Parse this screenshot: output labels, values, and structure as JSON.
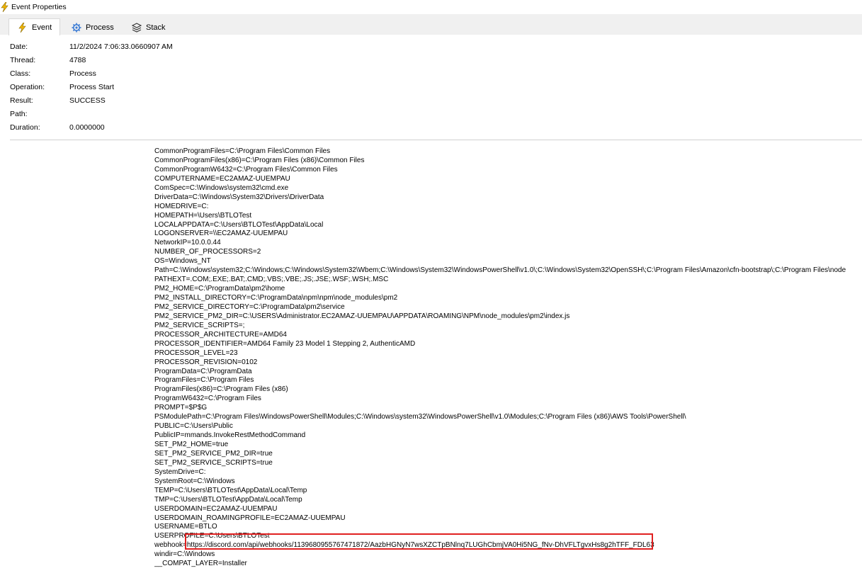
{
  "window": {
    "title": "Event Properties",
    "title_icon": "lightning-bolt-icon"
  },
  "tabs": [
    {
      "label": "Event",
      "icon": "lightning-bolt-icon",
      "active": true
    },
    {
      "label": "Process",
      "icon": "gear-icon",
      "active": false
    },
    {
      "label": "Stack",
      "icon": "stack-layers-icon",
      "active": false
    }
  ],
  "properties": [
    {
      "label": "Date:",
      "value": "11/2/2024 7:06:33.0660907 AM"
    },
    {
      "label": "Thread:",
      "value": "4788"
    },
    {
      "label": "Class:",
      "value": "Process"
    },
    {
      "label": "Operation:",
      "value": "Process Start"
    },
    {
      "label": "Result:",
      "value": "SUCCESS"
    },
    {
      "label": "Path:",
      "value": ""
    },
    {
      "label": "Duration:",
      "value": "0.0000000"
    }
  ],
  "environment": [
    "CommonProgramFiles=C:\\Program Files\\Common Files",
    "CommonProgramFiles(x86)=C:\\Program Files (x86)\\Common Files",
    "CommonProgramW6432=C:\\Program Files\\Common Files",
    "COMPUTERNAME=EC2AMAZ-UUEMPAU",
    "ComSpec=C:\\Windows\\system32\\cmd.exe",
    "DriverData=C:\\Windows\\System32\\Drivers\\DriverData",
    "HOMEDRIVE=C:",
    "HOMEPATH=\\Users\\BTLOTest",
    "LOCALAPPDATA=C:\\Users\\BTLOTest\\AppData\\Local",
    "LOGONSERVER=\\\\EC2AMAZ-UUEMPAU",
    "NetworkIP=10.0.0.44",
    "NUMBER_OF_PROCESSORS=2",
    "OS=Windows_NT",
    "Path=C:\\Windows\\system32;C:\\Windows;C:\\Windows\\System32\\Wbem;C:\\Windows\\System32\\WindowsPowerShell\\v1.0\\;C:\\Windows\\System32\\OpenSSH\\;C:\\Program Files\\Amazon\\cfn-bootstrap\\;C:\\Program Files\\node",
    "PATHEXT=.COM;.EXE;.BAT;.CMD;.VBS;.VBE;.JS;.JSE;.WSF;.WSH;.MSC",
    "PM2_HOME=C:\\ProgramData\\pm2\\home",
    "PM2_INSTALL_DIRECTORY=C:\\ProgramData\\npm\\npm\\node_modules\\pm2",
    "PM2_SERVICE_DIRECTORY=C:\\ProgramData\\pm2\\service",
    "PM2_SERVICE_PM2_DIR=C:\\USERS\\Administrator.EC2AMAZ-UUEMPAU\\APPDATA\\ROAMING\\NPM\\node_modules\\pm2\\index.js",
    "PM2_SERVICE_SCRIPTS=;",
    "PROCESSOR_ARCHITECTURE=AMD64",
    "PROCESSOR_IDENTIFIER=AMD64 Family 23 Model 1 Stepping 2, AuthenticAMD",
    "PROCESSOR_LEVEL=23",
    "PROCESSOR_REVISION=0102",
    "ProgramData=C:\\ProgramData",
    "ProgramFiles=C:\\Program Files",
    "ProgramFiles(x86)=C:\\Program Files (x86)",
    "ProgramW6432=C:\\Program Files",
    "PROMPT=$P$G",
    "PSModulePath=C:\\Program Files\\WindowsPowerShell\\Modules;C:\\Windows\\system32\\WindowsPowerShell\\v1.0\\Modules;C:\\Program Files (x86)\\AWS Tools\\PowerShell\\",
    "PUBLIC=C:\\Users\\Public",
    "PublicIP=mmands.InvokeRestMethodCommand",
    "SET_PM2_HOME=true",
    "SET_PM2_SERVICE_PM2_DIR=true",
    "SET_PM2_SERVICE_SCRIPTS=true",
    "SystemDrive=C:",
    "SystemRoot=C:\\Windows",
    "TEMP=C:\\Users\\BTLOTest\\AppData\\Local\\Temp",
    "TMP=C:\\Users\\BTLOTest\\AppData\\Local\\Temp",
    "USERDOMAIN=EC2AMAZ-UUEMPAU",
    "USERDOMAIN_ROAMINGPROFILE=EC2AMAZ-UUEMPAU",
    "USERNAME=BTLO",
    "USERPROFILE=C:\\Users\\BTLOTest",
    "webhook=https://discord.com/api/webhooks/1139680955767471872/AazbHGNyN7wsXZCTpBNlnq7LUGhCbmjVA0Hi5NG_fNv-DhVFLTgvxHs8g2hTFF_FDL63",
    "windir=C:\\Windows",
    "__COMPAT_LAYER=Installer"
  ],
  "annotation": {
    "highlight_color": "#e02020"
  }
}
